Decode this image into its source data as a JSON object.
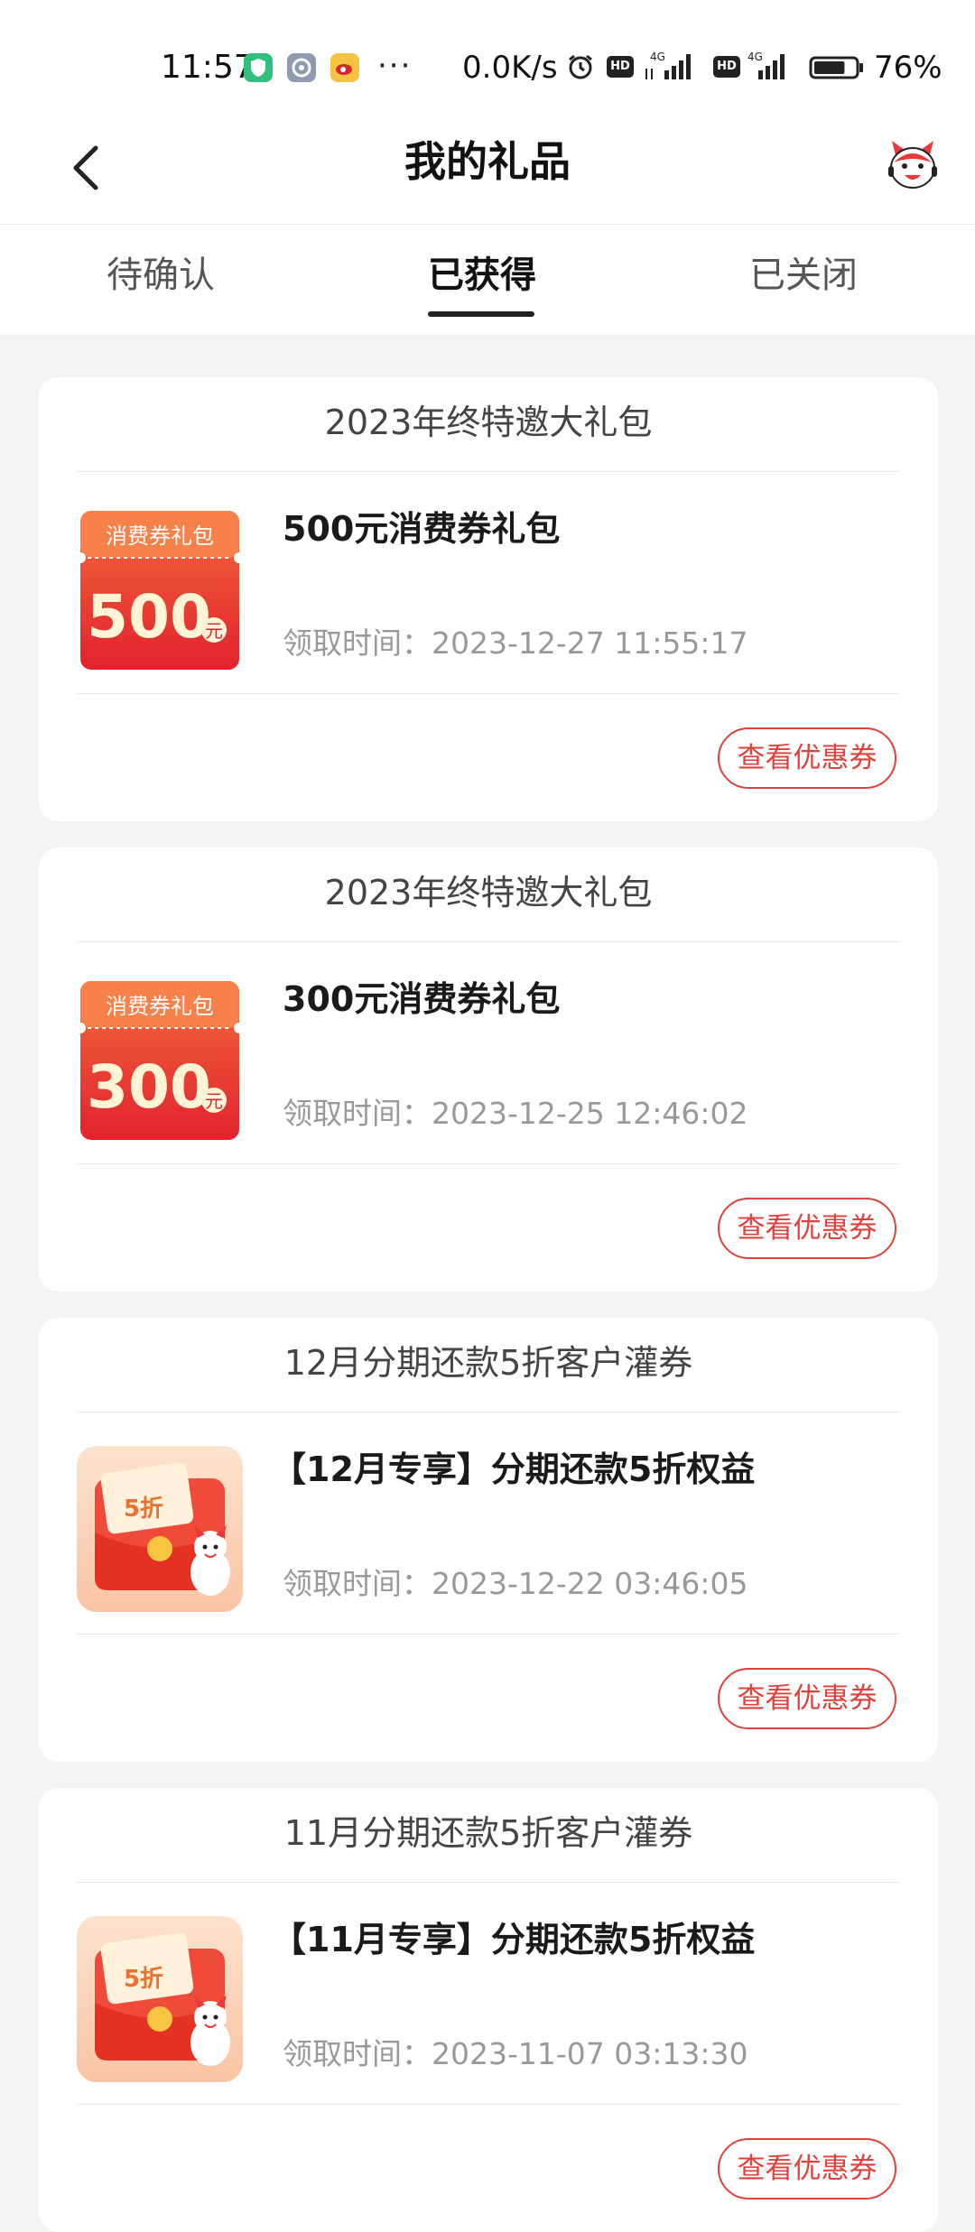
{
  "status_bar": {
    "time": "11:57",
    "dots": "···",
    "net_speed": "0.0K/s",
    "hd1": "HD",
    "hd2": "HD",
    "net1": "4G",
    "net2": "4G",
    "battery_pct": "76%",
    "battery_level": 0.76
  },
  "nav": {
    "title": "我的礼品"
  },
  "tabs": [
    {
      "label": "待确认",
      "active": false
    },
    {
      "label": "已获得",
      "active": true
    },
    {
      "label": "已关闭",
      "active": false
    }
  ],
  "thumb_text": {
    "voucher_header": "消费券礼包",
    "yuan": "元",
    "discount": "5折"
  },
  "cards": [
    {
      "title": "2023年终特邀大礼包",
      "gift_name": "500元消费券礼包",
      "gift_time": "领取时间：2023-12-27 11:55:17",
      "thumb_type": "voucher",
      "thumb_amount": "500",
      "button_label": "查看优惠券"
    },
    {
      "title": "2023年终特邀大礼包",
      "gift_name": "300元消费券礼包",
      "gift_time": "领取时间：2023-12-25 12:46:02",
      "thumb_type": "voucher",
      "thumb_amount": "300",
      "button_label": "查看优惠券"
    },
    {
      "title": "12月分期还款5折客户灌券",
      "gift_name": "【12月专享】分期还款5折权益",
      "gift_time": "领取时间：2023-12-22 03:46:05",
      "thumb_type": "discount",
      "button_label": "查看优惠券"
    },
    {
      "title": "11月分期还款5折客户灌券",
      "gift_name": "【11月专享】分期还款5折权益",
      "gift_time": "领取时间：2023-11-07 03:13:30",
      "thumb_type": "discount",
      "button_label": "查看优惠券"
    }
  ],
  "colors": {
    "accent_red": "#e0413a",
    "page_bg": "#f4f4f4"
  }
}
